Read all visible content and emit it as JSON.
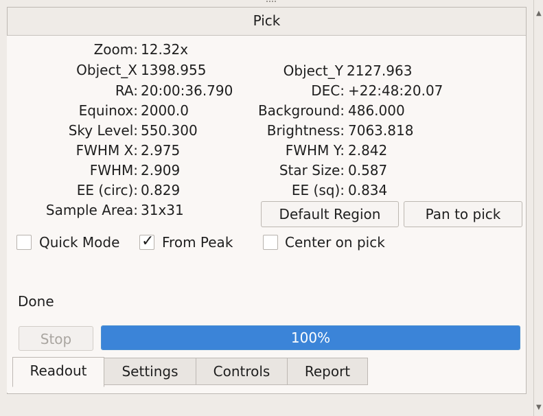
{
  "window": {
    "title": "Pick"
  },
  "readout": {
    "left": [
      {
        "label": "Zoom:",
        "value": "12.32x"
      },
      {
        "label": "Object_X",
        "value": "1398.955"
      },
      {
        "label": "RA:",
        "value": "20:00:36.790"
      },
      {
        "label": "Equinox:",
        "value": "2000.0"
      },
      {
        "label": "Sky Level:",
        "value": "550.300"
      },
      {
        "label": "FWHM X:",
        "value": "2.975"
      },
      {
        "label": "FWHM:",
        "value": "2.909"
      },
      {
        "label": "EE (circ):",
        "value": "0.829"
      },
      {
        "label": "Sample Area:",
        "value": "31x31"
      }
    ],
    "right": [
      {
        "label": "Object_Y",
        "value": "2127.963"
      },
      {
        "label": "DEC:",
        "value": "+22:48:20.07"
      },
      {
        "label": "Background:",
        "value": "486.000"
      },
      {
        "label": "Brightness:",
        "value": "7063.818"
      },
      {
        "label": "FWHM Y:",
        "value": "2.842"
      },
      {
        "label": "Star Size:",
        "value": "0.587"
      },
      {
        "label": "EE (sq):",
        "value": "0.834"
      }
    ]
  },
  "buttons": {
    "default_region": "Default Region",
    "pan_to_pick": "Pan to pick",
    "stop": "Stop"
  },
  "checkboxes": {
    "quick_mode": {
      "label": "Quick Mode",
      "checked": false
    },
    "from_peak": {
      "label": "From Peak",
      "checked": true,
      "mark": "✓"
    },
    "center_on_pick": {
      "label": "Center on pick",
      "checked": false
    }
  },
  "status": {
    "text": "Done"
  },
  "progress": {
    "value": 1.0,
    "label": "100%"
  },
  "tabs": [
    {
      "label": "Readout",
      "active": true
    },
    {
      "label": "Settings",
      "active": false
    },
    {
      "label": "Controls",
      "active": false
    },
    {
      "label": "Report",
      "active": false
    }
  ],
  "scrollbar": {
    "up_icon": "▲",
    "down_icon": "▼"
  },
  "colors": {
    "accent": "#3b84d8",
    "background": "#faf7f5",
    "frame": "#efebe7"
  }
}
